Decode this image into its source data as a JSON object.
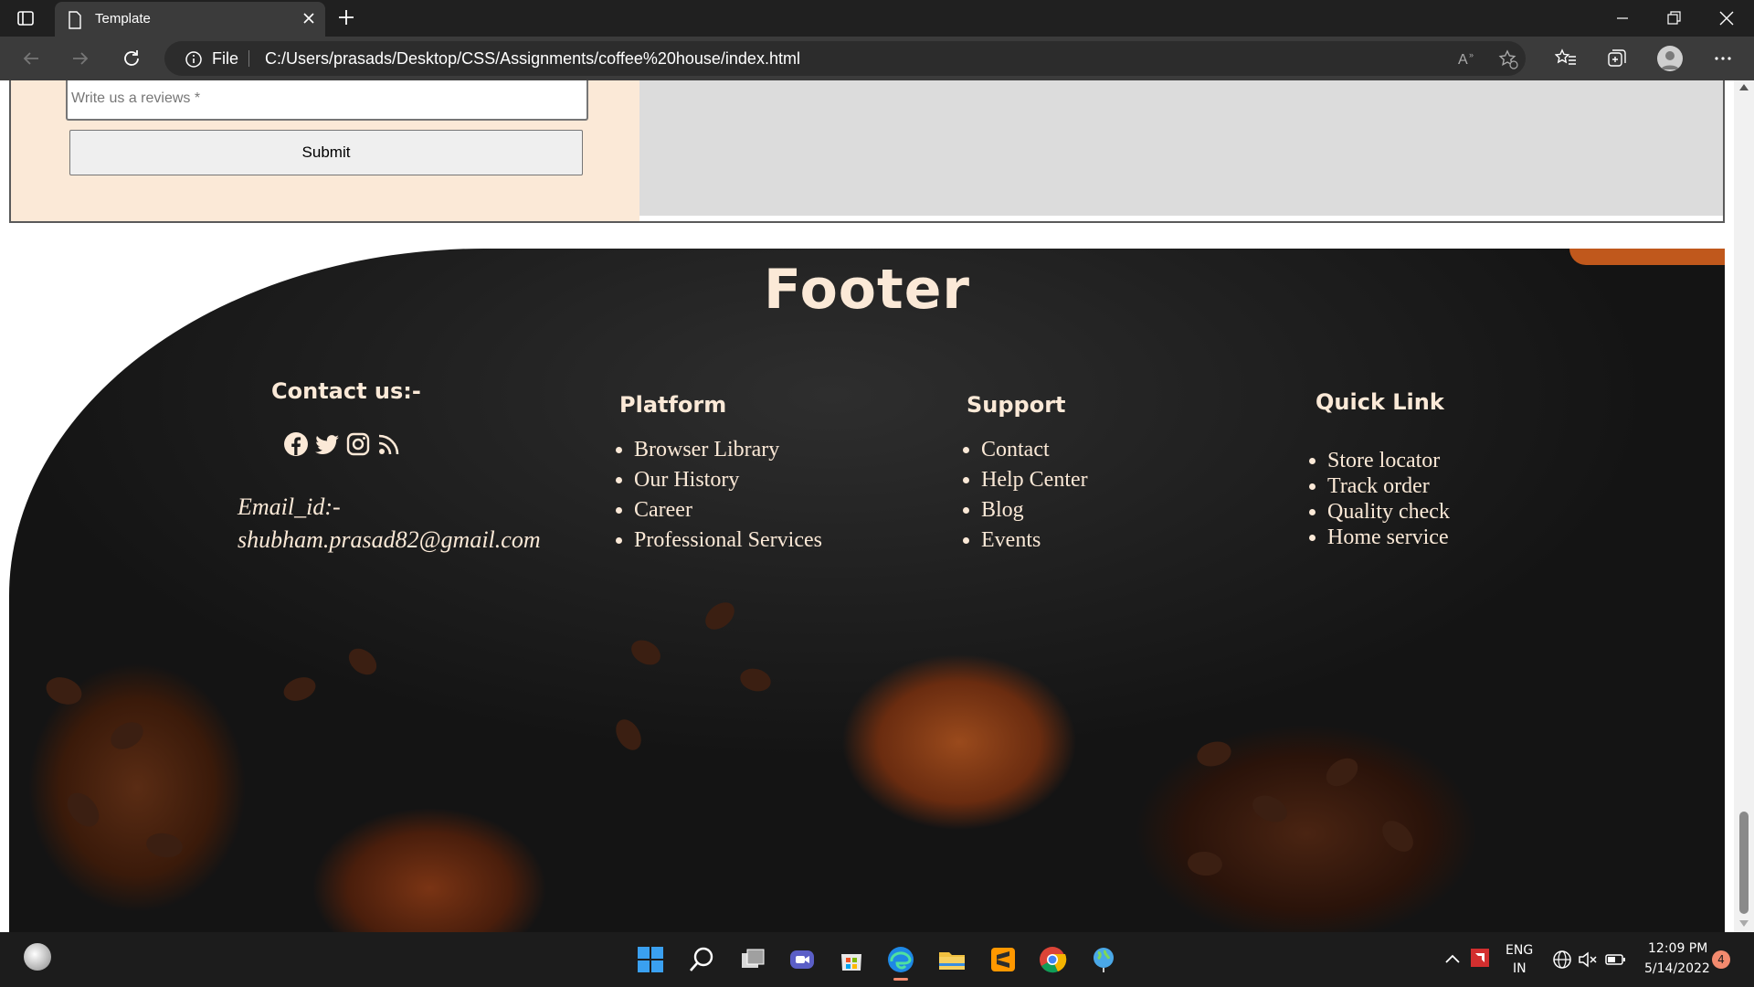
{
  "browser": {
    "tab_title": "Template",
    "address_scheme": "File",
    "url": "C:/Users/prasads/Desktop/CSS/Assignments/coffee%20house/index.html"
  },
  "review_form": {
    "review_placeholder": "Write us a reviews *",
    "submit_label": "Submit"
  },
  "footer": {
    "title": "Footer",
    "contact": {
      "heading": "Contact us:-",
      "social_icons": [
        "facebook-icon",
        "twitter-icon",
        "instagram-icon",
        "rss-icon"
      ],
      "email_label": "Email_id:-",
      "email_value": "shubham.prasad82@gmail.com"
    },
    "platform": {
      "heading": "Platform",
      "items": [
        "Browser Library",
        "Our History",
        "Career",
        "Professional Services"
      ]
    },
    "support": {
      "heading": "Support",
      "items": [
        "Contact",
        "Help Center",
        "Blog",
        "Events"
      ]
    },
    "quick_link": {
      "heading": "Quick Link",
      "items": [
        "Store locator",
        "Track order",
        "Quality check",
        "Home service"
      ]
    }
  },
  "taskbar": {
    "lang_line1": "ENG",
    "lang_line2": "IN",
    "time": "12:09 PM",
    "date": "5/14/2022",
    "notification_count": "4"
  },
  "colors": {
    "footer_text": "#fbe9d7",
    "review_panel": "#fbe9d7",
    "accent": "#c0581c"
  }
}
